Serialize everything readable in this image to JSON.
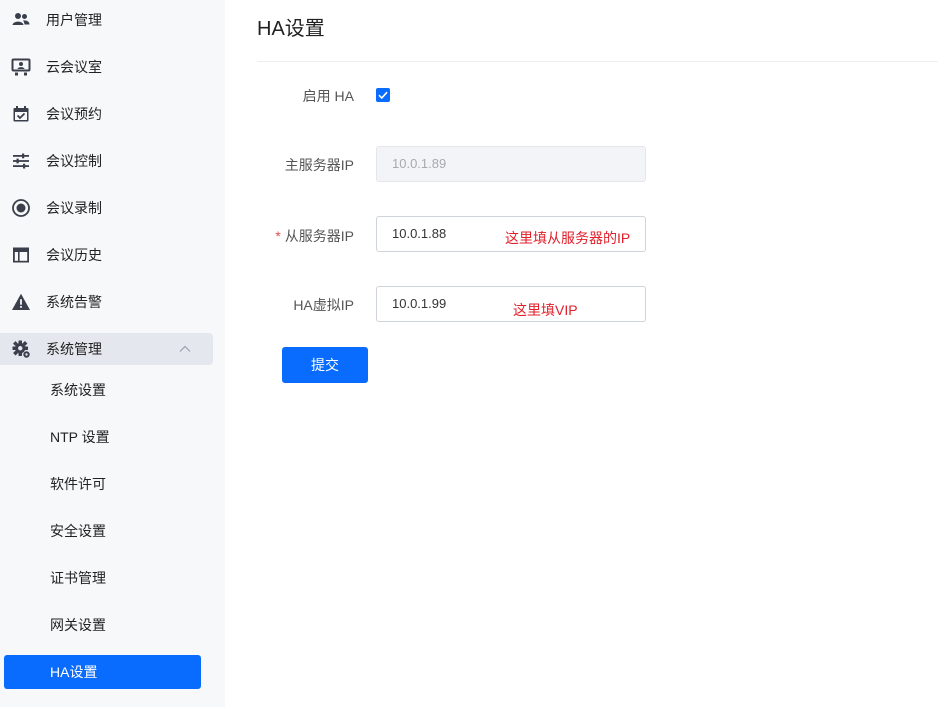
{
  "sidebar": {
    "items": [
      {
        "label": "用户管理",
        "icon": "users-icon"
      },
      {
        "label": "云会议室",
        "icon": "meeting-room-icon"
      },
      {
        "label": "会议预约",
        "icon": "calendar-check-icon"
      },
      {
        "label": "会议控制",
        "icon": "sliders-icon"
      },
      {
        "label": "会议录制",
        "icon": "record-icon"
      },
      {
        "label": "会议历史",
        "icon": "history-table-icon"
      },
      {
        "label": "系统告警",
        "icon": "warning-icon"
      },
      {
        "label": "系统管理",
        "icon": "gear-icon",
        "expanded": true
      }
    ],
    "subitems": [
      {
        "label": "系统设置"
      },
      {
        "label": "NTP 设置"
      },
      {
        "label": "软件许可"
      },
      {
        "label": "安全设置"
      },
      {
        "label": "证书管理"
      },
      {
        "label": "网关设置"
      },
      {
        "label": "HA设置",
        "active": true
      }
    ]
  },
  "main": {
    "title": "HA设置",
    "form": {
      "enable_ha_label": "启用 HA",
      "enable_ha_checked": true,
      "primary_ip_label": "主服务器IP",
      "primary_ip_value": "10.0.1.89",
      "secondary_ip_required_mark": "*",
      "secondary_ip_label": "从服务器IP",
      "secondary_ip_value": "10.0.1.88",
      "vip_label": "HA虚拟IP",
      "vip_value": "10.0.1.99",
      "submit_label": "提交"
    },
    "annotations": {
      "secondary_ip_note": "这里填从服务器的IP",
      "vip_note": "这里填VIP"
    }
  },
  "colors": {
    "accent": "#0a6cff",
    "annotation_red": "#e2202a",
    "sidebar_bg": "#f7f8fa",
    "group_open_bg": "#e5e7ee"
  }
}
